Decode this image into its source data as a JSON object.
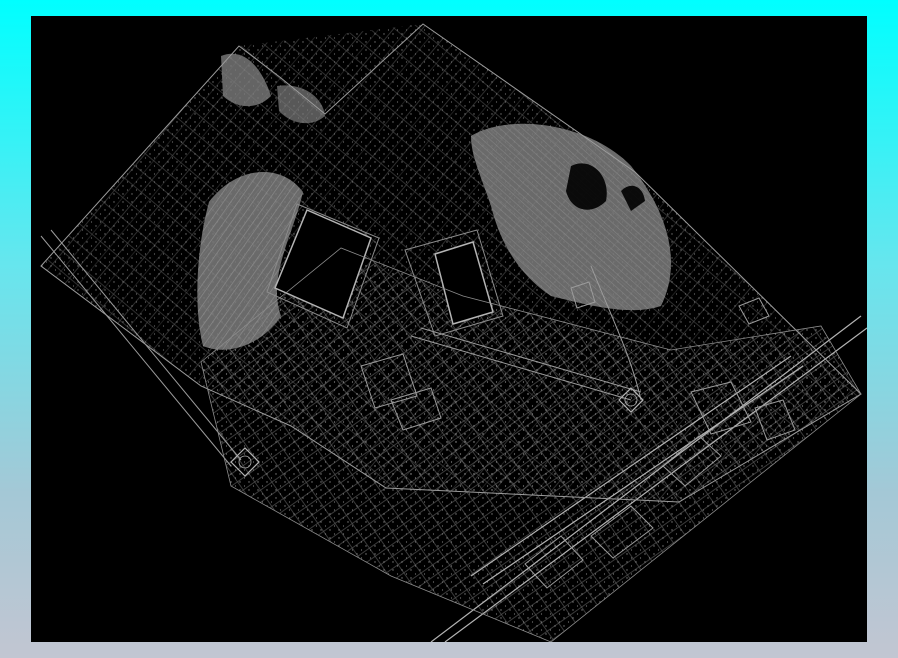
{
  "frame": {
    "background_top": "#00ffff",
    "background_bottom": "#c2c6d2"
  },
  "viewport": {
    "background": "#000000",
    "line_color": "#8c8c8c",
    "fill_color": "#7d7d7d",
    "accent_color": "#b4b4b4"
  },
  "drawing": {
    "type": "cad-site-plan",
    "features": [
      "north-sheet-boundary",
      "south-sheet-boundary",
      "left-pond",
      "right-pond",
      "east-hill",
      "west-hill",
      "main-road",
      "secondary-road",
      "roundabout-east",
      "roundabout-west",
      "building-blocks"
    ]
  }
}
